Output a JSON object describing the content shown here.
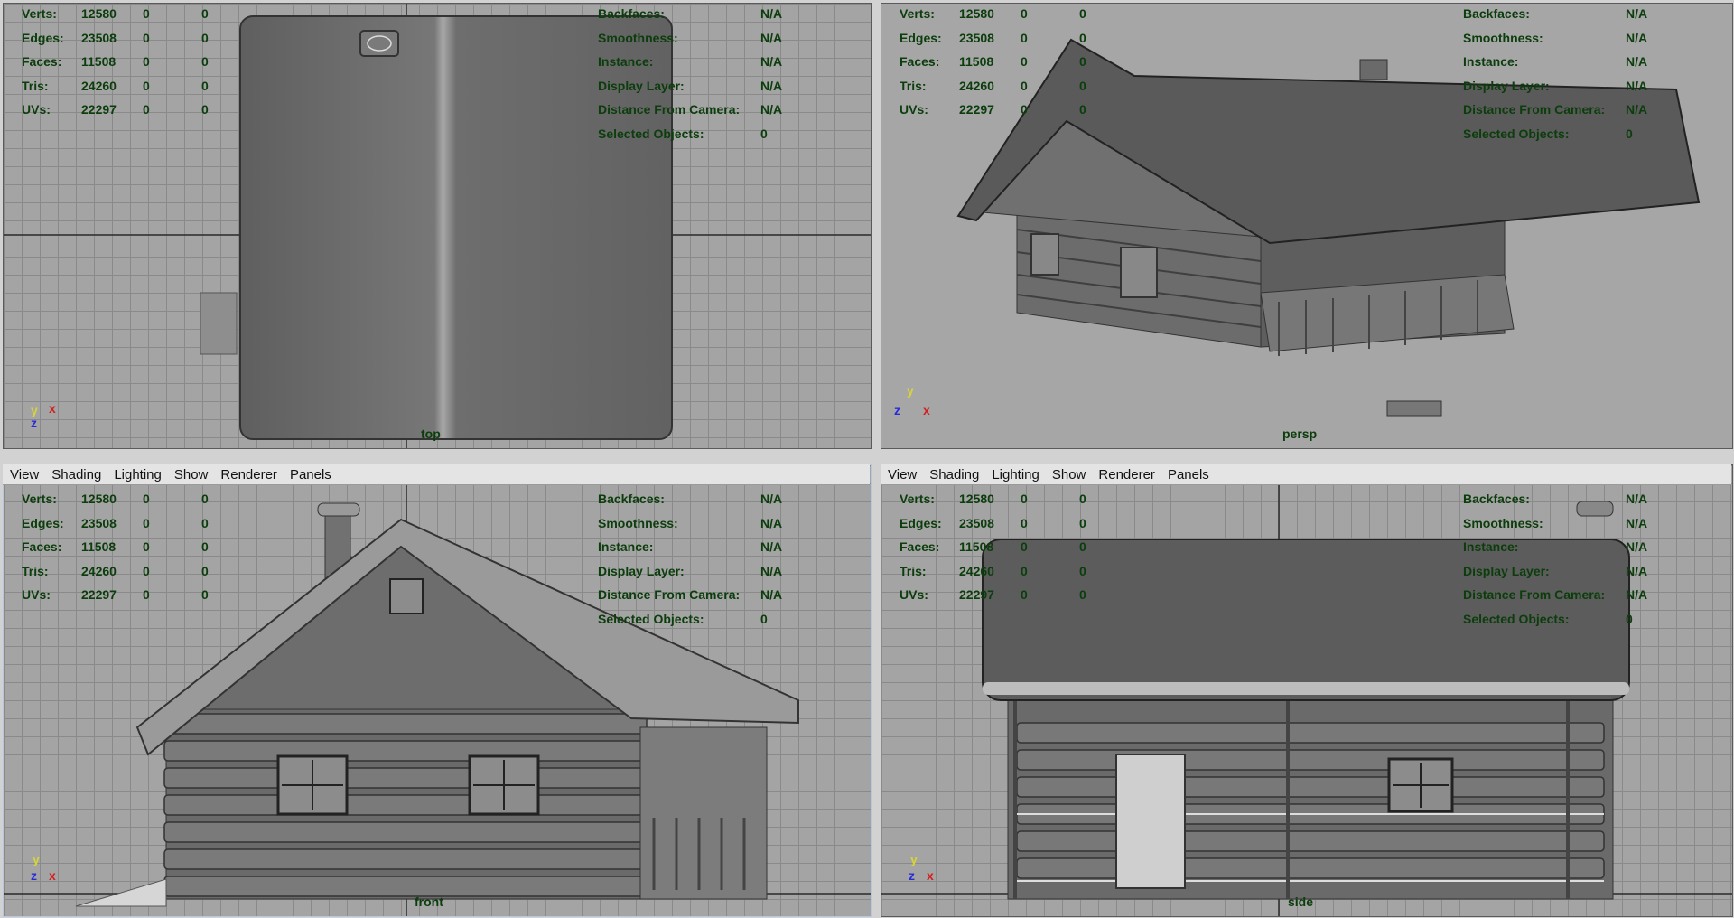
{
  "stats_labels": {
    "verts": "Verts:",
    "edges": "Edges:",
    "faces": "Faces:",
    "tris": "Tris:",
    "uvs": "UVs:"
  },
  "stats_values": {
    "verts": [
      "12580",
      "0",
      "0"
    ],
    "edges": [
      "23508",
      "0",
      "0"
    ],
    "faces": [
      "11508",
      "0",
      "0"
    ],
    "tris": [
      "24260",
      "0",
      "0"
    ],
    "uvs": [
      "22297",
      "0",
      "0"
    ]
  },
  "info_labels": {
    "backfaces": "Backfaces:",
    "smoothness": "Smoothness:",
    "instance": "Instance:",
    "display_layer": "Display Layer:",
    "distance": "Distance From Camera:",
    "selected": "Selected Objects:"
  },
  "info_values": {
    "backfaces": "N/A",
    "smoothness": "N/A",
    "instance": "N/A",
    "display_layer": "N/A",
    "distance": "N/A",
    "selected": "0"
  },
  "menu": [
    "View",
    "Shading",
    "Lighting",
    "Show",
    "Renderer",
    "Panels"
  ],
  "cameras": {
    "top": "top",
    "persp": "persp",
    "front": "front",
    "side": "side"
  },
  "axes": {
    "x": "x",
    "y": "y",
    "z": "z"
  },
  "colors": {
    "hud_text": "#0c3d0c",
    "axis_x": "#d21f1f",
    "axis_y": "#d7d43b",
    "axis_z": "#2b2bd6"
  }
}
